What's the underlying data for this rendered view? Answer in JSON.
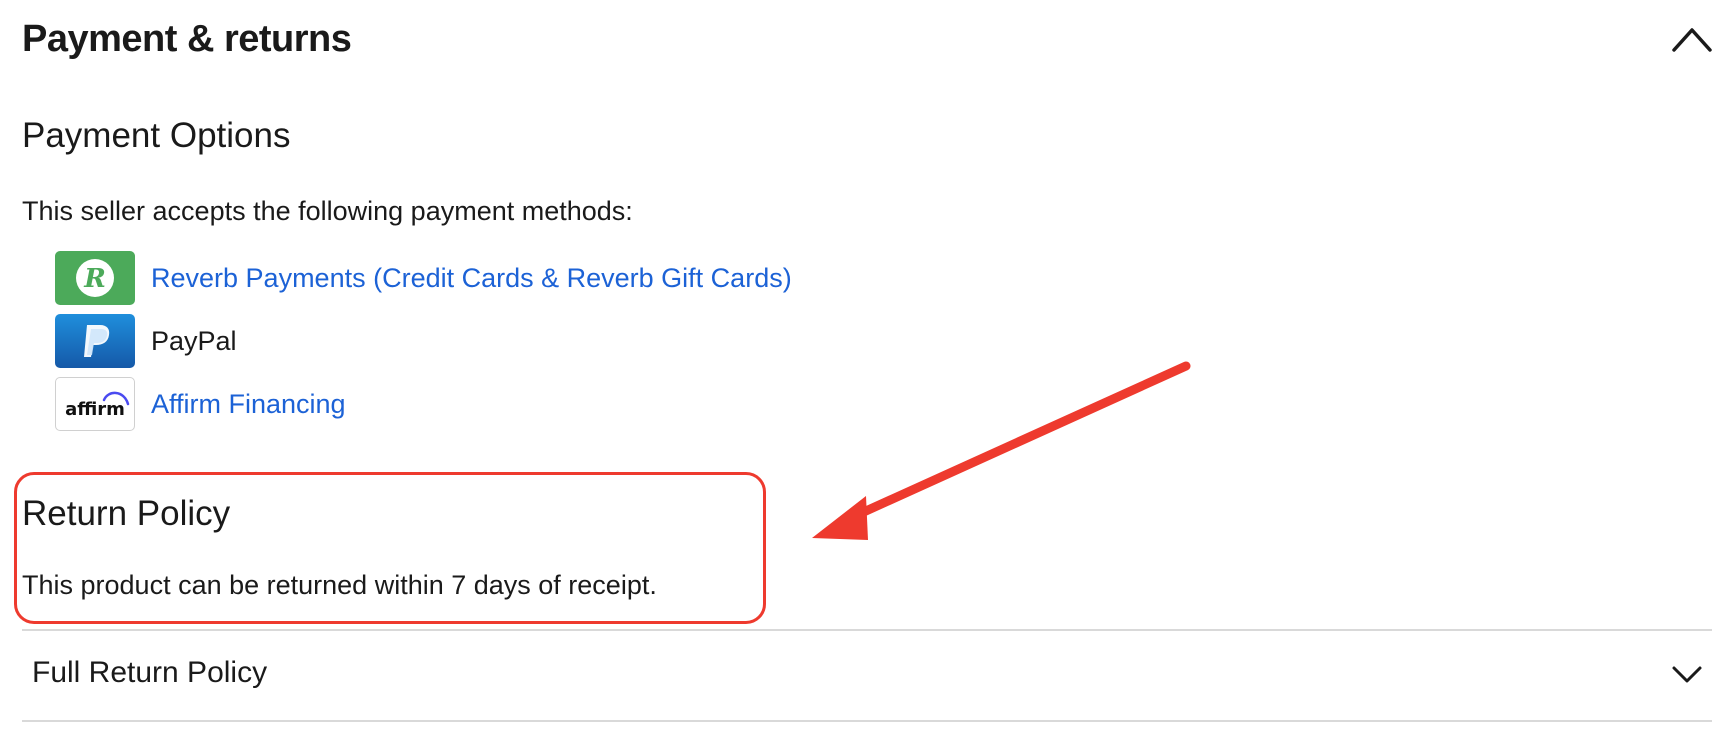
{
  "section": {
    "title": "Payment & returns"
  },
  "payment": {
    "heading": "Payment Options",
    "intro": "This seller accepts the following payment methods:",
    "methods": [
      {
        "icon": "reverb-icon",
        "label": "Reverb Payments (Credit Cards & Reverb Gift Cards)",
        "is_link": true
      },
      {
        "icon": "paypal-icon",
        "label": "PayPal",
        "is_link": false
      },
      {
        "icon": "affirm-icon",
        "label": "Affirm Financing",
        "is_link": true
      }
    ],
    "affirm_logo_text": "affirm"
  },
  "returns": {
    "heading": "Return Policy",
    "text": "This product can be returned within 7 days of receipt."
  },
  "accordion": {
    "full_return_policy_label": "Full Return Policy"
  },
  "colors": {
    "link": "#1c62d6",
    "annotation_red": "#ee3a2e",
    "reverb_green": "#4caa5a",
    "paypal_blue": "#1559a8"
  }
}
